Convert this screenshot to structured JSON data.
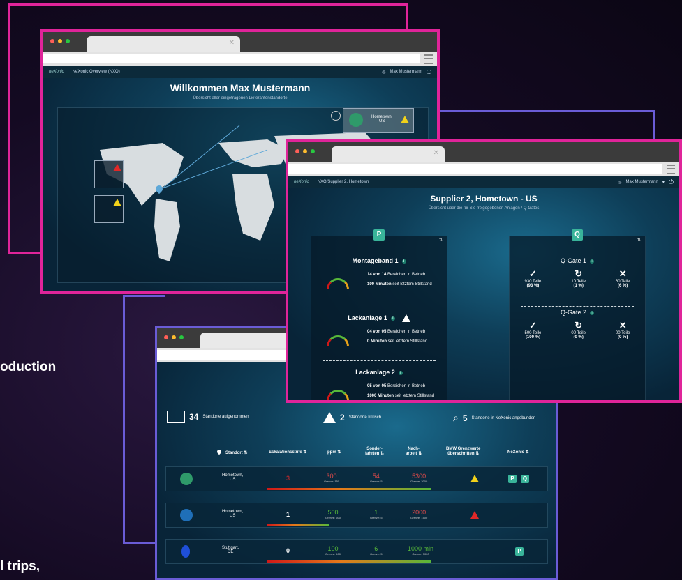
{
  "colors": {
    "pink": "#e0249a",
    "purple": "#6a5cd6",
    "teal": "#39b49a",
    "red": "#e02828",
    "yellow": "#f2d21a",
    "green": "#57b83a"
  },
  "side_text": {
    "production": "oduction",
    "trips": "l trips,"
  },
  "overview_window": {
    "app_name": "NeXonic Overview (NXO)",
    "logo": "neXonic",
    "user": "Max Mustermann",
    "title": "Willkommen Max Mustermann",
    "subtitle": "Übersicht aller eingetragenen Lieferantenstandorte",
    "location_card": {
      "name": "Hometown,",
      "country": "US",
      "icon": "warning-icon"
    }
  },
  "supplier_window": {
    "breadcrumb": "NXO/Supplier 2, Hometown",
    "logo": "neXonic",
    "user": "Max Mustermann",
    "title": "Supplier 2, Hometown - US",
    "subtitle": "Übersicht über die für Sie freigegebenen Anlagen / Q-Gates",
    "p_panel": {
      "letter": "P",
      "items": [
        {
          "name": "Montageband 1",
          "line1_bold": "14 von 14",
          "line1": "Bereichen in Betrieb",
          "line2_bold": "100 Minuten",
          "line2": "seit letztem Stillstand",
          "warn": false
        },
        {
          "name": "Lackanlage 1",
          "line1_bold": "04 von 05",
          "line1": "Bereichen in Betrieb",
          "line2_bold": "0 Minuten",
          "line2": "seit letztem Stillstand",
          "warn": true
        },
        {
          "name": "Lackanlage 2",
          "line1_bold": "05 von 05",
          "line1": "Bereichen in Betrieb",
          "line2_bold": "1000 Minuten",
          "line2": "seit letztem Stillstand",
          "warn": false
        }
      ]
    },
    "q_panel": {
      "letter": "Q",
      "gates": [
        {
          "name": "Q-Gate 1",
          "cols": [
            {
              "icon": "✓",
              "a": "930 Teile",
              "b": "(93 %)"
            },
            {
              "icon": "↻",
              "a": "10 Teile",
              "b": "(1 %)"
            },
            {
              "icon": "✕",
              "a": "60 Teile",
              "b": "(6 %)"
            }
          ]
        },
        {
          "name": "Q-Gate 2",
          "cols": [
            {
              "icon": "✓",
              "a": "500 Teile",
              "b": "(100 %)"
            },
            {
              "icon": "↻",
              "a": "00 Teile",
              "b": "(0 %)"
            },
            {
              "icon": "✕",
              "a": "00 Teile",
              "b": "(0 %)"
            }
          ]
        }
      ]
    }
  },
  "table_window": {
    "stats": [
      {
        "value": "34",
        "label": "Standorte aufgenommen",
        "icon": "factory-icon"
      },
      {
        "value": "2",
        "label": "Standorte kritisch",
        "icon": "warning-icon"
      },
      {
        "value": "5",
        "label": "Standorte in NeXonic angebunden",
        "icon": "search-icon"
      }
    ],
    "headers": [
      "Standort",
      "Eskalationsstufe",
      "ppm",
      "Sonder-\nfahrten",
      "Nach-\narbeit",
      "BMW Grenzwerte\nüberschritten",
      "NeXonic"
    ],
    "rows": [
      {
        "name": "Hometown,",
        "country": "US",
        "esc": "3",
        "ppm": "300",
        "ppm_limit": "Grenze: 150",
        "sf": "54",
        "sf_limit": "Grenze: 5",
        "na": "5300",
        "na_limit": "Grenze: 3000",
        "flag": "yellow",
        "nexonic": [
          "P",
          "Q"
        ]
      },
      {
        "name": "Hometown,",
        "country": "US",
        "esc": "1",
        "ppm": "500",
        "ppm_limit": "Grenze: 600",
        "sf": "1",
        "sf_limit": "Grenze: 5",
        "na": "2000",
        "na_limit": "Grenze: 1500",
        "flag": "red",
        "nexonic": []
      },
      {
        "name": "Stuttgart,",
        "country": "DE",
        "esc": "0",
        "ppm": "100",
        "ppm_limit": "Grenze: 400",
        "sf": "6",
        "sf_limit": "Grenze: 5",
        "na": "1000 min",
        "na_limit": "Grenze: 3000",
        "flag": "",
        "nexonic": [
          "P"
        ]
      }
    ]
  }
}
